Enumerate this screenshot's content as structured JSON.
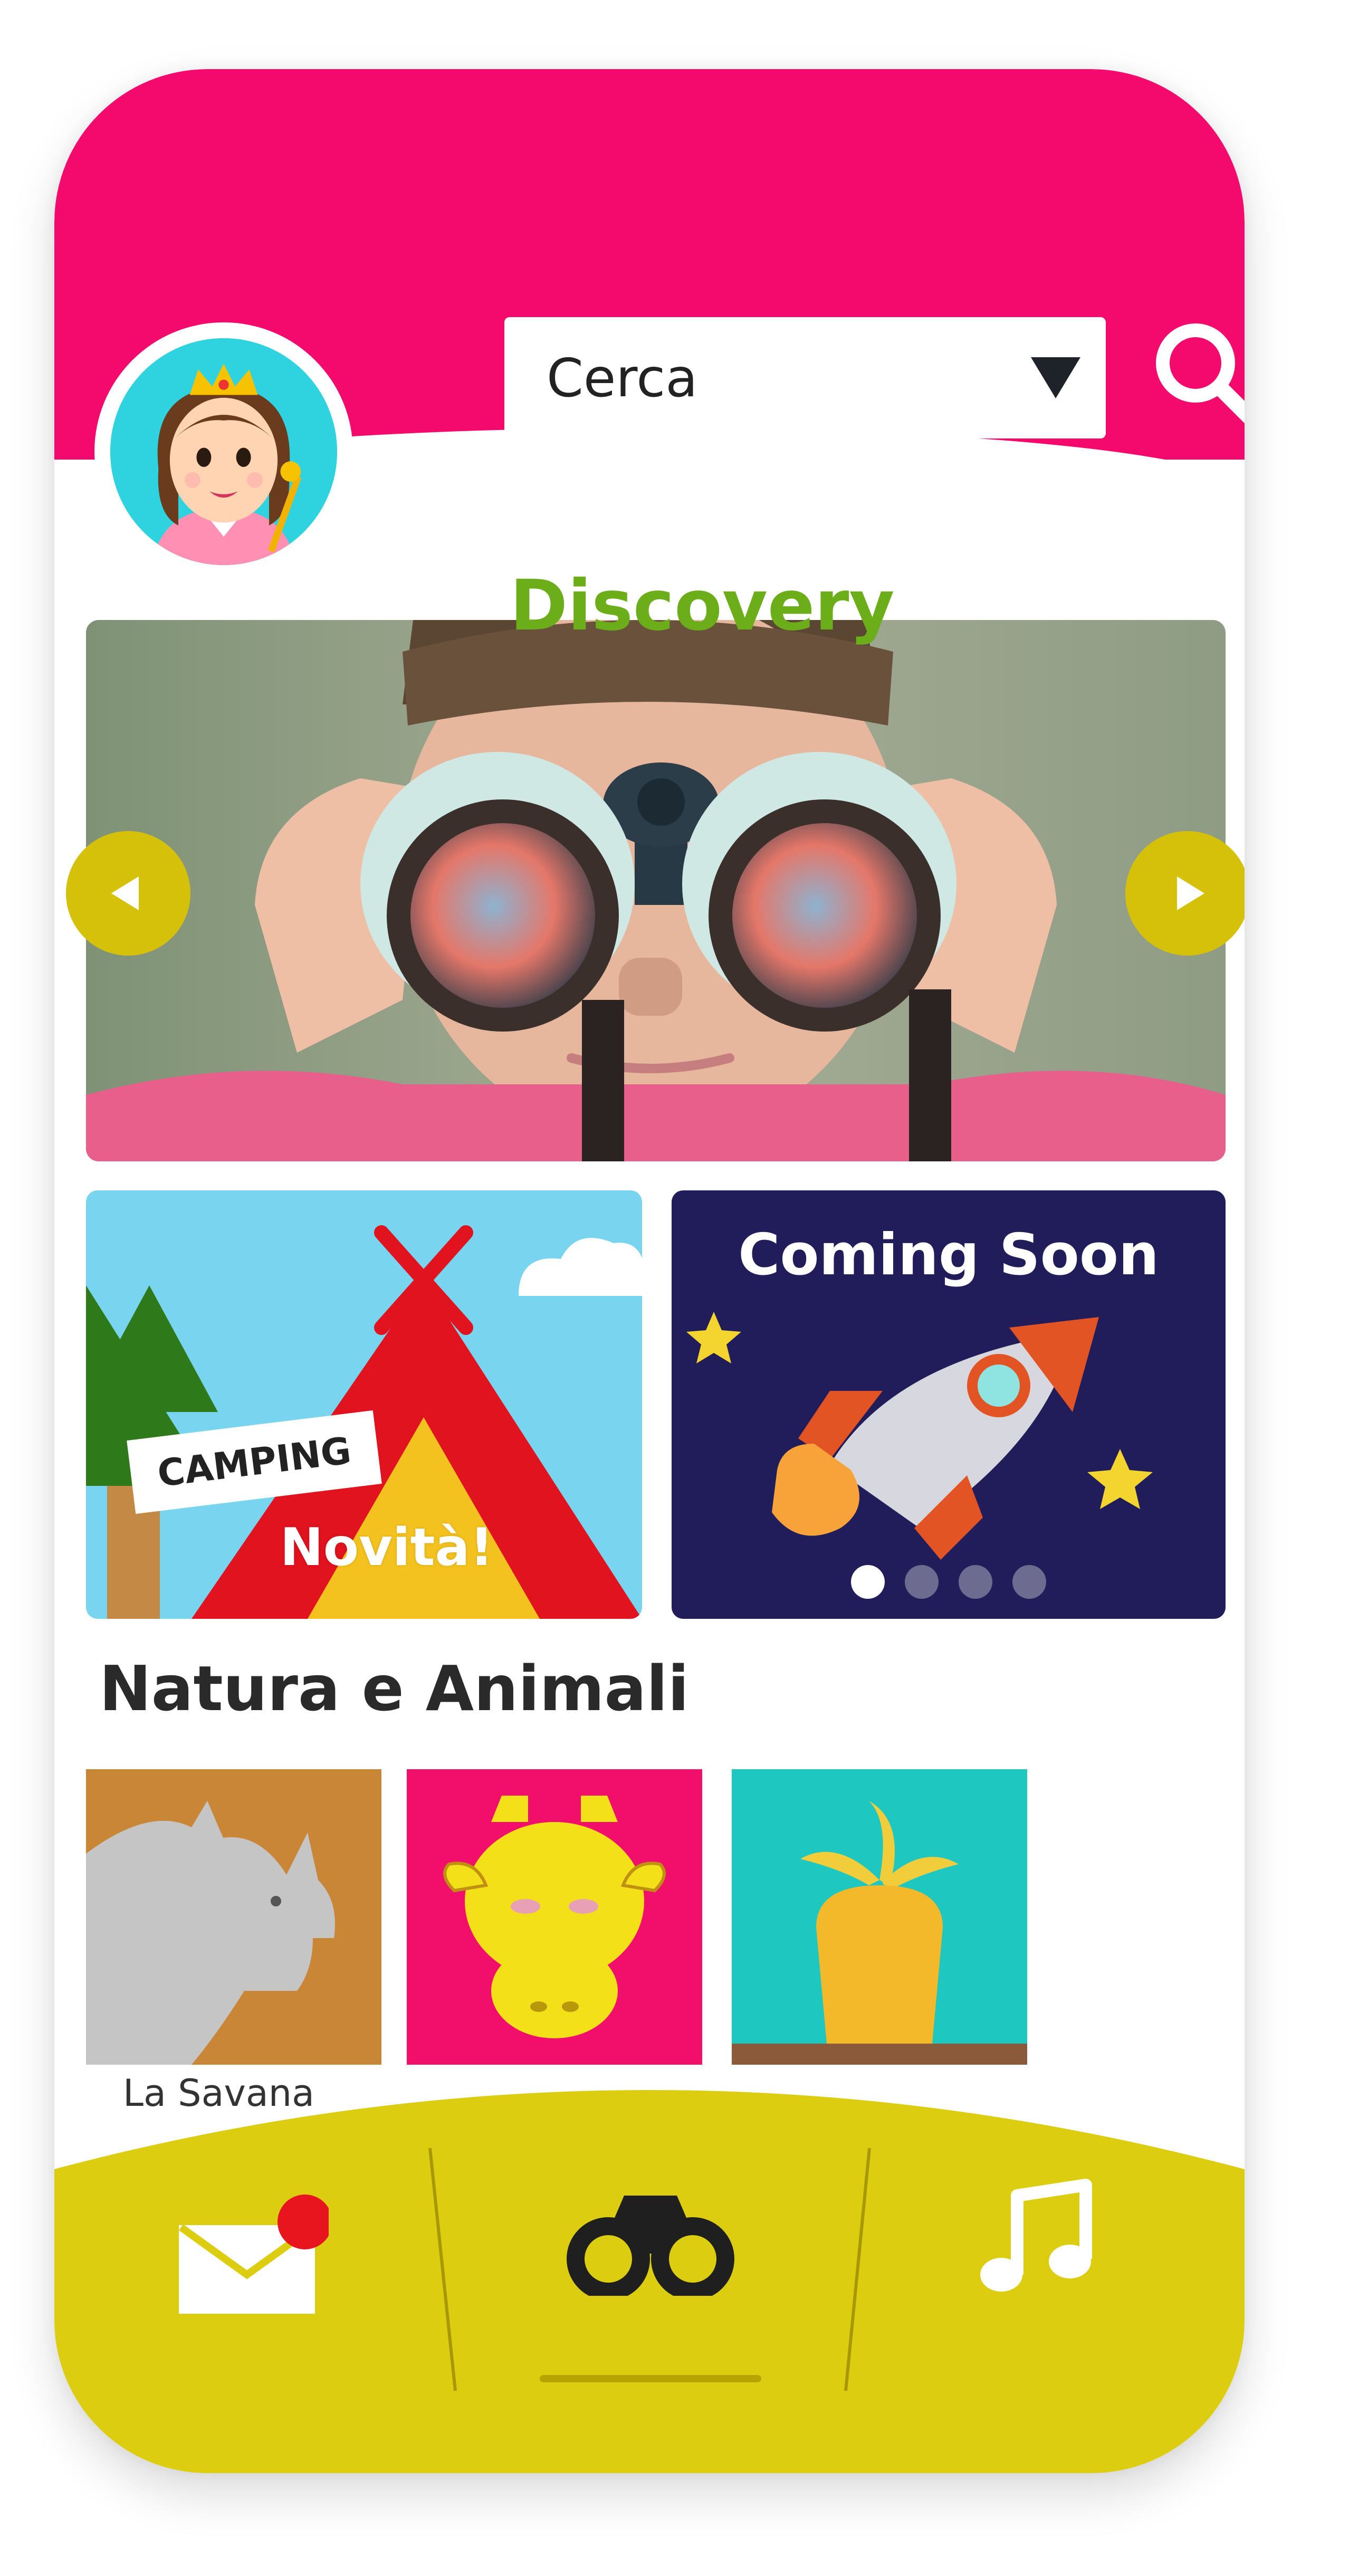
{
  "header": {
    "search": {
      "placeholder": "Cerca"
    },
    "accent_color": "#f30a6c"
  },
  "main": {
    "title": "Discovery",
    "title_color": "#6cae1a",
    "hero": {
      "image": "child-with-binoculars"
    },
    "promo_cards": [
      {
        "id": "camping",
        "sign": "CAMPING",
        "badge": "Novità!"
      },
      {
        "id": "coming-soon",
        "title": "Coming Soon",
        "dots": 4,
        "active_dot": 1
      }
    ],
    "section": {
      "title": "Natura e Animali",
      "tiles": [
        {
          "icon": "rhino-icon",
          "label": "La Savana"
        },
        {
          "icon": "giraffe-icon",
          "label": ""
        },
        {
          "icon": "carrot-icon",
          "label": ""
        }
      ]
    }
  },
  "bottom_nav": {
    "items": [
      {
        "icon": "mail-icon",
        "has_notification": true
      },
      {
        "icon": "binoculars-icon"
      },
      {
        "icon": "music-note-icon"
      }
    ],
    "bar_color": "#dccd10"
  }
}
